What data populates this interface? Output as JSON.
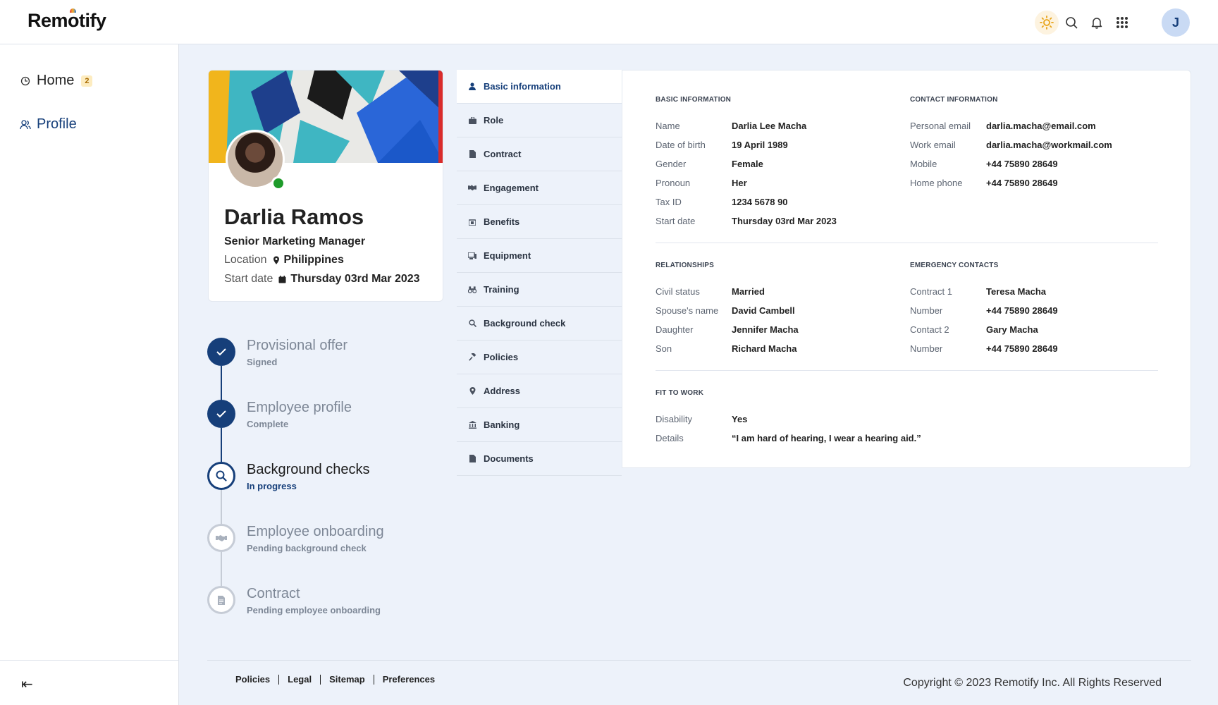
{
  "app": {
    "logo_text_a": "Rem",
    "logo_text_o": "o",
    "logo_text_b": "tify"
  },
  "topbar": {
    "icons": [
      "sun-icon",
      "search-icon",
      "bell-icon",
      "apps-grid-icon"
    ],
    "user_initial": "J"
  },
  "sidebar": {
    "items": [
      {
        "label": "Home",
        "badge": "2",
        "icon": "clock-icon"
      },
      {
        "label": "Profile",
        "icon": "users-icon"
      }
    ],
    "collapse_icon": "collapse-icon",
    "collapse_glyph": "⇤"
  },
  "profile": {
    "name": "Darlia Ramos",
    "title": "Senior Marketing Manager",
    "location_label": "Location",
    "location_value": "Philippines",
    "start_label": "Start date",
    "start_value": "Thursday 03rd Mar 2023",
    "status_color": "#1e9b2a"
  },
  "steps": [
    {
      "title": "Provisional offer",
      "sub": "Signed",
      "state": "done"
    },
    {
      "title": "Employee profile",
      "sub": "Complete",
      "state": "done"
    },
    {
      "title": "Background checks",
      "sub": "In progress",
      "state": "active"
    },
    {
      "title": "Employee onboarding",
      "sub": "Pending background check",
      "state": "pending"
    },
    {
      "title": "Contract",
      "sub": "Pending employee onboarding",
      "state": "pending"
    }
  ],
  "tabs": [
    {
      "label": "Basic information",
      "icon": "person-icon",
      "active": true
    },
    {
      "label": "Role",
      "icon": "briefcase-icon"
    },
    {
      "label": "Contract",
      "icon": "document-icon"
    },
    {
      "label": "Engagement",
      "icon": "handshake-icon"
    },
    {
      "label": "Benefits",
      "icon": "gift-icon"
    },
    {
      "label": "Equipment",
      "icon": "monitor-icon"
    },
    {
      "label": "Training",
      "icon": "binoculars-icon"
    },
    {
      "label": "Background check",
      "icon": "search-icon"
    },
    {
      "label": "Policies",
      "icon": "gavel-icon"
    },
    {
      "label": "Address",
      "icon": "pin-icon"
    },
    {
      "label": "Banking",
      "icon": "bank-icon"
    },
    {
      "label": "Documents",
      "icon": "file-icon"
    }
  ],
  "details": {
    "basic": {
      "heading": "BASIC INFORMATION",
      "rows": [
        {
          "k": "Name",
          "v": "Darlia Lee Macha"
        },
        {
          "k": "Date of birth",
          "v": "19 April 1989"
        },
        {
          "k": "Gender",
          "v": "Female"
        },
        {
          "k": "Pronoun",
          "v": "Her"
        },
        {
          "k": "Tax ID",
          "v": "1234 5678 90"
        },
        {
          "k": "Start date",
          "v": "Thursday 03rd Mar 2023"
        }
      ]
    },
    "contact": {
      "heading": "CONTACT INFORMATION",
      "rows": [
        {
          "k": "Personal email",
          "v": "darlia.macha@email.com"
        },
        {
          "k": "Work email",
          "v": "darlia.macha@workmail.com"
        },
        {
          "k": "Mobile",
          "v": "+44 75890 28649"
        },
        {
          "k": "Home phone",
          "v": "+44 75890 28649"
        }
      ]
    },
    "relationships": {
      "heading": "RELATIONSHIPS",
      "rows": [
        {
          "k": "Civil status",
          "v": "Married"
        },
        {
          "k": "Spouse's name",
          "v": "David Cambell"
        },
        {
          "k": "Daughter",
          "v": "Jennifer Macha"
        },
        {
          "k": "Son",
          "v": "Richard Macha"
        }
      ]
    },
    "emergency": {
      "heading": "EMERGENCY CONTACTS",
      "rows": [
        {
          "k": "Contract 1",
          "v": "Teresa Macha"
        },
        {
          "k": "Number",
          "v": "+44 75890 28649"
        },
        {
          "k": "Contact 2",
          "v": "Gary Macha"
        },
        {
          "k": "Number",
          "v": "+44 75890 28649"
        }
      ]
    },
    "fit": {
      "heading": "FIT TO WORK",
      "rows": [
        {
          "k": "Disability",
          "v": "Yes"
        },
        {
          "k": "Details",
          "v": "“I am hard of hearing, I wear a hearing aid.”"
        }
      ]
    }
  },
  "footer": {
    "links": [
      "Policies",
      "Legal",
      "Sitemap",
      "Preferences"
    ],
    "copyright": "Copyright © 2023 Remotify Inc. All Rights Reserved"
  },
  "colors": {
    "brand": "#163f7a",
    "background": "#edf2fa",
    "online": "#1e9b2a"
  }
}
